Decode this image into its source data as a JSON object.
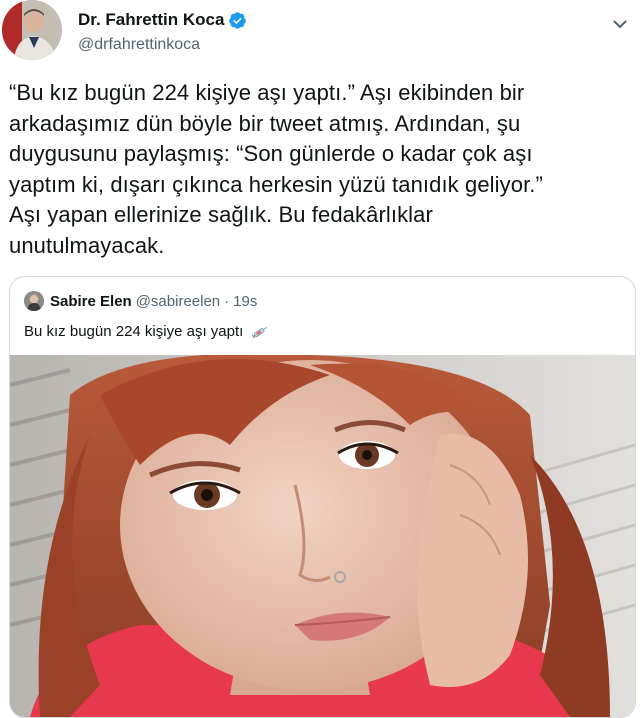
{
  "author": {
    "display_name": "Dr. Fahrettin Koca",
    "handle": "@drfahrettinkoca",
    "verified": true,
    "avatar_icon": "avatar-photo"
  },
  "tweet": {
    "text": "“Bu kız bugün 224 kişiye aşı yaptı.” Aşı ekibinden bir\narkadaşımız dün böyle bir tweet atmış. Ardından, şu\nduygusunu paylaşmış: “Son günlerde o kadar çok aşı\nyaptım ki, dışarı çıkınca herkesin yüzü tanıdık geliyor.”\nAşı yapan ellerinize sağlık. Bu fedakârlıklar\nunutulmayacak."
  },
  "quoted_tweet": {
    "display_name": "Sabire Elen",
    "handle": "@sabireelen",
    "separator": "·",
    "time": "19s",
    "text": "Bu kız bugün 224 kişiye aşı yaptı",
    "emoji_icon": "syringe-icon"
  },
  "colors": {
    "text_primary": "#0f1419",
    "text_secondary": "#536471",
    "verified_blue": "#1d9bf0",
    "border": "#cfd9de"
  }
}
